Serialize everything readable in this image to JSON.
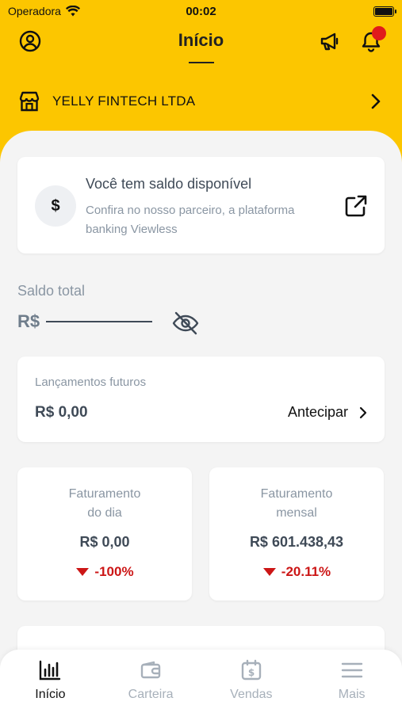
{
  "status_bar": {
    "carrier": "Operadora",
    "time": "00:02"
  },
  "header": {
    "title": "Início"
  },
  "company": {
    "name": "YELLY FINTECH LTDA"
  },
  "saldo_card": {
    "icon_symbol": "$",
    "title": "Você tem saldo disponível",
    "subtitle": "Confira no nosso parceiro, a plataforma banking Viewless"
  },
  "saldo_total": {
    "label": "Saldo total",
    "currency": "R$"
  },
  "lancamentos": {
    "label": "Lançamentos futuros",
    "value": "R$ 0,00",
    "action_label": "Antecipar"
  },
  "faturamento": [
    {
      "label_line1": "Faturamento",
      "label_line2": "do dia",
      "value": "R$ 0,00",
      "change": "-100%"
    },
    {
      "label_line1": "Faturamento",
      "label_line2": "mensal",
      "value": "R$ 601.438,43",
      "change": "-20.11%"
    }
  ],
  "tabbar": {
    "tabs": [
      {
        "label": "Início",
        "icon": "bar-chart-icon",
        "active": true
      },
      {
        "label": "Carteira",
        "icon": "wallet-icon",
        "active": false
      },
      {
        "label": "Vendas",
        "icon": "calendar-dollar-icon",
        "active": false
      },
      {
        "label": "Mais",
        "icon": "menu-icon",
        "active": false
      }
    ]
  },
  "colors": {
    "brand_yellow": "#fcc600",
    "negative": "#cc1616",
    "text_dark": "#3f4a57",
    "text_muted": "#8a96a3",
    "notification": "#e01b1b"
  }
}
